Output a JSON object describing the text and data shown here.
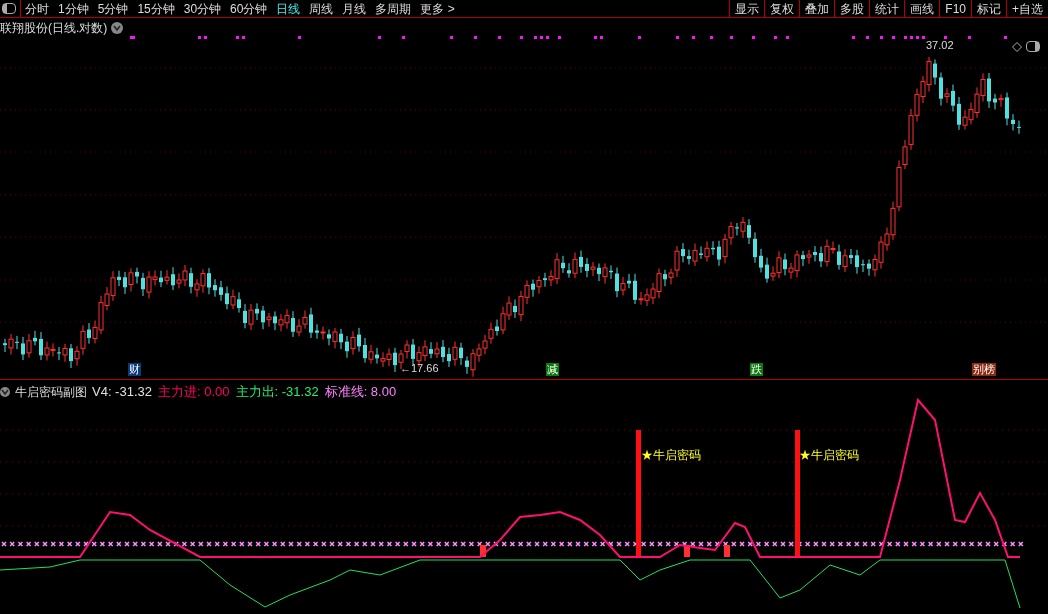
{
  "toolbar": {
    "periods": [
      {
        "label": "分时",
        "selected": false
      },
      {
        "label": "1分钟",
        "selected": false
      },
      {
        "label": "5分钟",
        "selected": false
      },
      {
        "label": "15分钟",
        "selected": false
      },
      {
        "label": "30分钟",
        "selected": false
      },
      {
        "label": "60分钟",
        "selected": false
      },
      {
        "label": "日线",
        "selected": true
      },
      {
        "label": "周线",
        "selected": false
      },
      {
        "label": "月线",
        "selected": false
      },
      {
        "label": "多周期",
        "selected": false
      },
      {
        "label": "更多 >",
        "selected": false
      }
    ],
    "tools": [
      "显示",
      "复权",
      "叠加",
      "多股",
      "统计",
      "画线",
      "F10",
      "标记",
      "+自选"
    ]
  },
  "main_chart": {
    "title": "联翔股份(日线.对数)",
    "high_label": "37.02",
    "low_label": "←17.66",
    "event_tags": [
      {
        "label": "财",
        "color": "#0a3a7a"
      },
      {
        "label": "减",
        "color": "#0a7a0a"
      },
      {
        "label": "跌",
        "color": "#0a7a0a"
      },
      {
        "label": "别榜",
        "color": "#8a2a10"
      }
    ]
  },
  "indicator": {
    "title": "牛启密码副图",
    "values": [
      {
        "label": "V4: -31.32",
        "color": "#e0e0e0"
      },
      {
        "label": "主力进: 0.00",
        "color": "#ff0066"
      },
      {
        "label": "主力出: -31.32",
        "color": "#20f070"
      },
      {
        "label": "标准线: 8.00",
        "color": "#ff80ff"
      }
    ],
    "signals": [
      "★牛启密码",
      "★牛启密码"
    ]
  }
}
